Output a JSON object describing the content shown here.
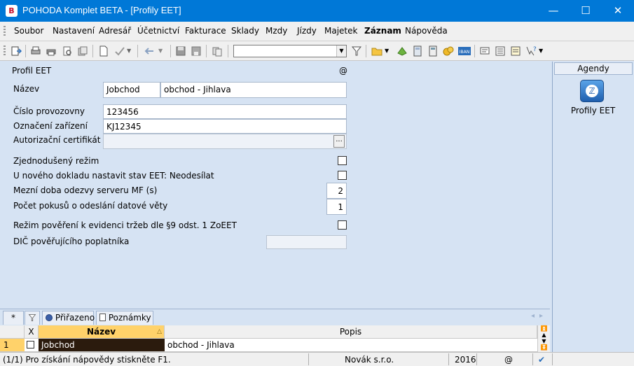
{
  "window": {
    "title": "POHODA Komplet BETA - [Profily EET]",
    "app_icon_text": "B",
    "minimize": "—",
    "maximize": "☐",
    "close": "✕"
  },
  "menu": [
    "Soubor",
    "Nastavení",
    "Adresář",
    "Účetnictví",
    "Fakturace",
    "Sklady",
    "Mzdy",
    "Jízdy",
    "Majetek",
    "Záznam",
    "Nápověda"
  ],
  "form": {
    "section_title": "Profil EET",
    "at_symbol": "@",
    "nazev_label": "Název",
    "nazev_code": "Jobchod",
    "nazev_text": "obchod - Jihlava",
    "provozovna_label": "Číslo provozovny",
    "provozovna_value": "123456",
    "zarizeni_label": "Označení zařízení",
    "zarizeni_value": "KJ12345",
    "certifikat_label": "Autorizační certifikát",
    "certifikat_value": "",
    "certifikat_button": "...",
    "zjednoduseny_label": "Zjednodušený režim",
    "zjednoduseny_checked": false,
    "novy_doklad_label": "U nového dokladu nastavit stav EET: Neodesílat",
    "novy_doklad_checked": false,
    "mezni_doba_label": "Mezní doba odezvy serveru MF (s)",
    "mezni_doba_value": "2",
    "pocet_pokusu_label": "Počet pokusů o odeslání datové věty",
    "pocet_pokusu_value": "1",
    "rezim_povereni_label": "Režim pověření k evidenci tržeb dle §9 odst. 1 ZoEET",
    "rezim_povereni_checked": false,
    "dic_label": "DIČ pověřujícího poplatníka",
    "dic_value": ""
  },
  "agendy": {
    "header": "Agendy",
    "item_label": "Profily EET",
    "icon_name": "eet-profile-icon"
  },
  "tabs": [
    {
      "label": "*"
    },
    {
      "label": ""
    },
    {
      "label": "Přiřazeno"
    },
    {
      "label": "Poznámky"
    }
  ],
  "grid": {
    "columns": [
      "X",
      "Název",
      "Popis"
    ],
    "rows": [
      {
        "index": "1",
        "checked": false,
        "nazev": "Jobchod",
        "popis": "obchod - Jihlava"
      }
    ]
  },
  "statusbar": {
    "hint": "(1/1) Pro získání nápovědy stiskněte F1.",
    "company": "Novák s.r.o.",
    "year": "2016",
    "at": "@"
  },
  "colors": {
    "titlebar": "#0078d7",
    "form_bg": "#d6e3f3",
    "selected_row": "#2b1b0d",
    "row_index": "#ffd26a"
  }
}
